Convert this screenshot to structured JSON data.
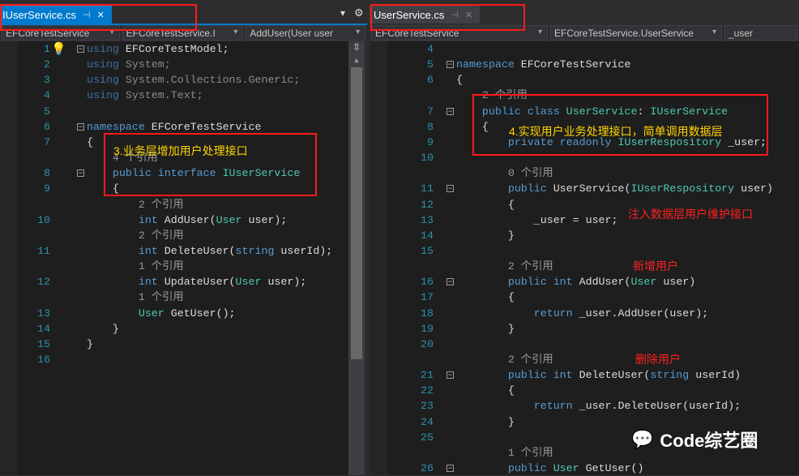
{
  "left": {
    "tab": {
      "label": "IUserService.cs",
      "pin": "⊣",
      "close": "✕"
    },
    "tab_menu": "▾",
    "settings": "⚙",
    "nav": [
      "EFCoreTestService",
      "EFCoreTestService.I",
      "AddUser(User user"
    ],
    "rows": [
      {
        "n": "1",
        "t": [
          [
            "using ",
            "dkw"
          ],
          [
            "EFCoreTestModel;",
            ""
          ]
        ]
      },
      {
        "n": "2",
        "t": [
          [
            "using ",
            "dkw"
          ],
          [
            "System;",
            "dim"
          ]
        ]
      },
      {
        "n": "3",
        "t": [
          [
            "using ",
            "dkw"
          ],
          [
            "System.Collections.Generic;",
            "dim"
          ]
        ]
      },
      {
        "n": "4",
        "t": [
          [
            "using ",
            "dkw"
          ],
          [
            "System.Text;",
            "dim"
          ]
        ]
      },
      {
        "n": "5",
        "t": []
      },
      {
        "n": "6",
        "t": [
          [
            "namespace ",
            "kw"
          ],
          [
            "EFCoreTestService",
            ""
          ]
        ]
      },
      {
        "n": "7",
        "t": [
          [
            "{",
            ""
          ]
        ]
      },
      {
        "n": "",
        "t": [
          [
            "    4 个引用",
            "lens"
          ]
        ]
      },
      {
        "n": "8",
        "t": [
          [
            "    public interface ",
            "kw"
          ],
          [
            "IUserService",
            "ty"
          ]
        ]
      },
      {
        "n": "9",
        "t": [
          [
            "    {",
            ""
          ]
        ]
      },
      {
        "n": "",
        "t": [
          [
            "        2 个引用",
            "lens"
          ]
        ]
      },
      {
        "n": "10",
        "t": [
          [
            "        int ",
            "kw"
          ],
          [
            "AddUser(",
            ""
          ],
          [
            "User",
            "ty"
          ],
          [
            " user);",
            ""
          ]
        ]
      },
      {
        "n": "",
        "t": [
          [
            "        2 个引用",
            "lens"
          ]
        ]
      },
      {
        "n": "11",
        "t": [
          [
            "        int ",
            "kw"
          ],
          [
            "DeleteUser(",
            ""
          ],
          [
            "string",
            "kw"
          ],
          [
            " userId);",
            ""
          ]
        ]
      },
      {
        "n": "",
        "t": [
          [
            "        1 个引用",
            "lens"
          ]
        ]
      },
      {
        "n": "12",
        "t": [
          [
            "        int ",
            "kw"
          ],
          [
            "UpdateUser(",
            ""
          ],
          [
            "User",
            "ty"
          ],
          [
            " user);",
            ""
          ]
        ]
      },
      {
        "n": "",
        "t": [
          [
            "        1 个引用",
            "lens"
          ]
        ]
      },
      {
        "n": "13",
        "t": [
          [
            "        User",
            "ty"
          ],
          [
            " GetUser();",
            ""
          ]
        ]
      },
      {
        "n": "14",
        "t": [
          [
            "    }",
            ""
          ]
        ]
      },
      {
        "n": "15",
        "t": [
          [
            "}",
            ""
          ]
        ]
      },
      {
        "n": "16",
        "t": []
      }
    ],
    "note": "3.业务层增加用户处理接口"
  },
  "right": {
    "tab": {
      "label": "UserService.cs",
      "pin": "⊣",
      "close": "✕"
    },
    "nav": [
      "EFCoreTestService",
      "EFCoreTestService.UserService",
      "_user"
    ],
    "rows": [
      {
        "n": "4",
        "t": []
      },
      {
        "n": "5",
        "t": [
          [
            "namespace ",
            "kw"
          ],
          [
            "EFCoreTestService",
            ""
          ]
        ]
      },
      {
        "n": "6",
        "t": [
          [
            "{",
            ""
          ]
        ]
      },
      {
        "n": "",
        "t": [
          [
            "    2 个引用",
            "lens"
          ]
        ]
      },
      {
        "n": "7",
        "t": [
          [
            "    public class ",
            "kw"
          ],
          [
            "UserService",
            "ty"
          ],
          [
            ": ",
            ""
          ],
          [
            "IUserService",
            "ty"
          ]
        ]
      },
      {
        "n": "8",
        "t": [
          [
            "    {",
            ""
          ]
        ]
      },
      {
        "n": "9",
        "t": [
          [
            "        private readonly ",
            "kw"
          ],
          [
            "IUserRespository",
            "ty"
          ],
          [
            " _user;",
            ""
          ]
        ]
      },
      {
        "n": "10",
        "t": []
      },
      {
        "n": "",
        "t": [
          [
            "        0 个引用",
            "lens"
          ]
        ]
      },
      {
        "n": "11",
        "t": [
          [
            "        public ",
            "kw"
          ],
          [
            "UserService(",
            ""
          ],
          [
            "IUserRespository",
            "ty"
          ],
          [
            " user)",
            ""
          ]
        ]
      },
      {
        "n": "12",
        "t": [
          [
            "        {",
            ""
          ]
        ]
      },
      {
        "n": "13",
        "t": [
          [
            "            _user = user;",
            ""
          ]
        ]
      },
      {
        "n": "14",
        "t": [
          [
            "        }",
            ""
          ]
        ]
      },
      {
        "n": "15",
        "t": []
      },
      {
        "n": "",
        "t": [
          [
            "        2 个引用",
            "lens"
          ]
        ]
      },
      {
        "n": "16",
        "t": [
          [
            "        public int ",
            "kw"
          ],
          [
            "AddUser(",
            ""
          ],
          [
            "User",
            "ty"
          ],
          [
            " user)",
            ""
          ]
        ]
      },
      {
        "n": "17",
        "t": [
          [
            "        {",
            ""
          ]
        ]
      },
      {
        "n": "18",
        "t": [
          [
            "            return ",
            "kw"
          ],
          [
            "_user.AddUser(user);",
            ""
          ]
        ]
      },
      {
        "n": "19",
        "t": [
          [
            "        }",
            ""
          ]
        ]
      },
      {
        "n": "20",
        "t": []
      },
      {
        "n": "",
        "t": [
          [
            "        2 个引用",
            "lens"
          ]
        ]
      },
      {
        "n": "21",
        "t": [
          [
            "        public int ",
            "kw"
          ],
          [
            "DeleteUser(",
            ""
          ],
          [
            "string",
            "kw"
          ],
          [
            " userId)",
            ""
          ]
        ]
      },
      {
        "n": "22",
        "t": [
          [
            "        {",
            ""
          ]
        ]
      },
      {
        "n": "23",
        "t": [
          [
            "            return ",
            "kw"
          ],
          [
            "_user.DeleteUser(userId);",
            ""
          ]
        ]
      },
      {
        "n": "24",
        "t": [
          [
            "        }",
            ""
          ]
        ]
      },
      {
        "n": "25",
        "t": []
      },
      {
        "n": "",
        "t": [
          [
            "        1 个引用",
            "lens"
          ]
        ]
      },
      {
        "n": "26",
        "t": [
          [
            "        public ",
            "kw"
          ],
          [
            "User",
            "ty"
          ],
          [
            " GetUser()",
            ""
          ]
        ]
      }
    ],
    "note": "4.实现用户业务处理接口，简单调用数据层",
    "notes_red": [
      "注入数据层用户维护接口",
      "新增用户",
      "删除用户"
    ]
  },
  "watermark": "Code综艺圈",
  "colors": {
    "accent": "#007acc",
    "annotation": "#ff1a1a",
    "note_yellow": "#ffd400"
  }
}
